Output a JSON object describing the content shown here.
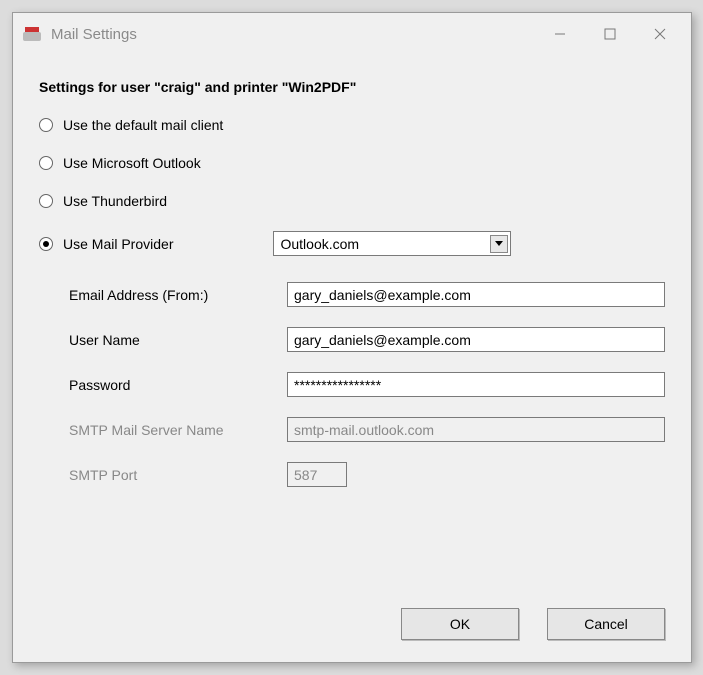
{
  "window": {
    "title": "Mail Settings"
  },
  "heading": "Settings for user \"craig\" and printer \"Win2PDF\"",
  "radios": {
    "default_client": "Use the default mail client",
    "outlook": "Use Microsoft Outlook",
    "thunderbird": "Use Thunderbird",
    "provider": "Use Mail Provider"
  },
  "provider_select": {
    "value": "Outlook.com"
  },
  "fields": {
    "email_label": "Email Address (From:)",
    "email_value": "gary_daniels@example.com",
    "user_label": "User Name",
    "user_value": "gary_daniels@example.com",
    "password_label": "Password",
    "password_value": "****************",
    "smtp_server_label": "SMTP Mail Server Name",
    "smtp_server_value": "smtp-mail.outlook.com",
    "smtp_port_label": "SMTP Port",
    "smtp_port_value": "587"
  },
  "buttons": {
    "ok": "OK",
    "cancel": "Cancel"
  }
}
